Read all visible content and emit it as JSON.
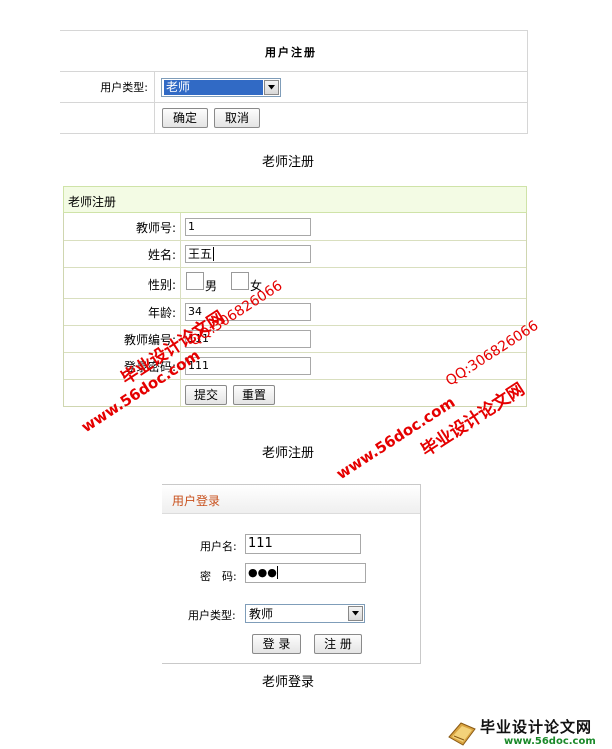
{
  "section1": {
    "title": "用户注册",
    "user_type_label": "用户类型:",
    "user_type_selected": "老师",
    "confirm_label": "确定",
    "cancel_label": "取消",
    "caption": "老师注册"
  },
  "section2": {
    "header": "老师注册",
    "fields": [
      {
        "label": "教师号:",
        "value": "1"
      },
      {
        "label": "姓名:",
        "value": "王五"
      },
      {
        "label": "性别:",
        "male": "男",
        "female": "女"
      },
      {
        "label": "年龄:",
        "value": "34"
      },
      {
        "label": "教师编号:",
        "value": "111"
      },
      {
        "label": "登录密码:",
        "value": "111"
      }
    ],
    "submit_label": "提交",
    "reset_label": "重置",
    "caption": "老师注册"
  },
  "section3": {
    "header": "用户登录",
    "username_label": "用户名:",
    "username_value": "111",
    "password_label": "密　码:",
    "password_value": "●●●",
    "user_type_label": "用户类型:",
    "user_type_selected": "教师",
    "login_label": "登 录",
    "register_label": "注 册",
    "caption": "老师登录"
  },
  "watermark": {
    "title": "毕业设计论文网",
    "site": "www.56doc.com",
    "qq": "QQ:306826066",
    "footer_title": "毕业设计论文网",
    "footer_site": "www.56doc.com",
    "color": "#e50000"
  }
}
